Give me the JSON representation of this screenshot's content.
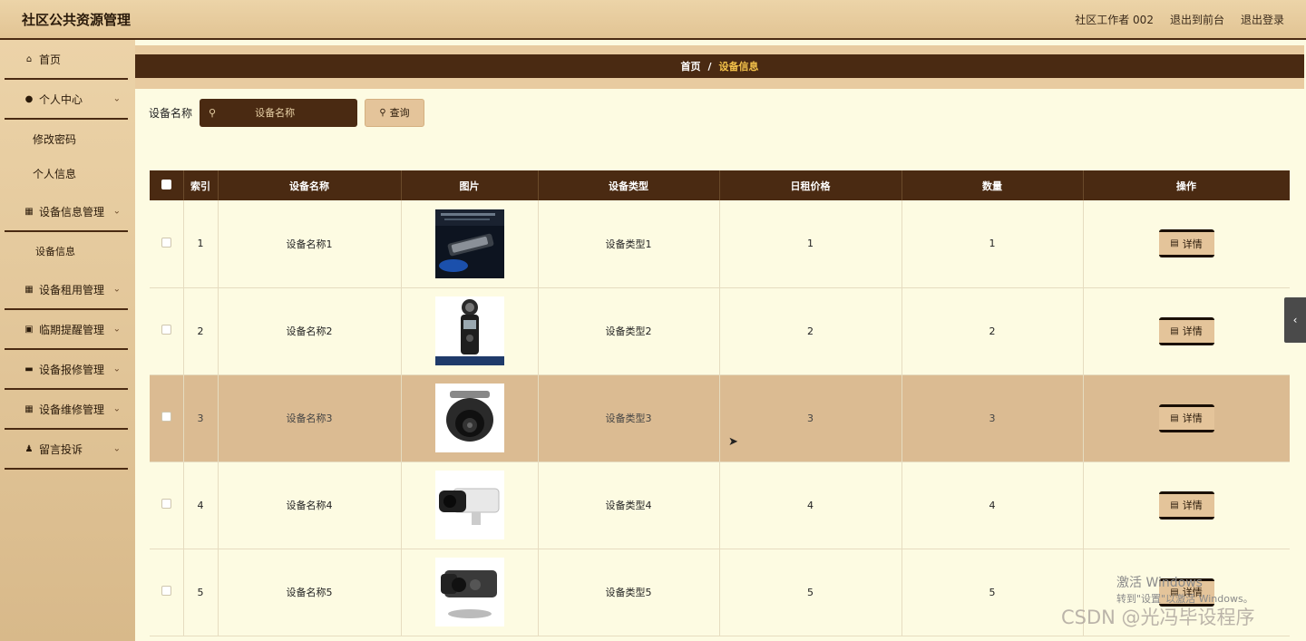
{
  "app": {
    "title": "社区公共资源管理",
    "user_label": "社区工作者 002",
    "to_front_label": "退出到前台",
    "logout_label": "退出登录"
  },
  "sidebar": {
    "home": "首页",
    "personal_center": "个人中心",
    "personal_sub": [
      "修改密码",
      "个人信息"
    ],
    "device_info_mgmt": "设备信息管理",
    "device_info_sub": "设备信息",
    "rental_mgmt": "设备租用管理",
    "expiry_mgmt": "临期提醒管理",
    "repair_report_mgmt": "设备报修管理",
    "maintenance_mgmt": "设备维修管理",
    "complaints": "留言投诉"
  },
  "breadcrumb": {
    "home": "首页",
    "separator": "/",
    "current": "设备信息"
  },
  "search": {
    "label": "设备名称",
    "placeholder": "设备名称",
    "button_label": "查询"
  },
  "table": {
    "headers": [
      "索引",
      "设备名称",
      "图片",
      "设备类型",
      "日租价格",
      "数量",
      "操作"
    ],
    "detail_label": "详情",
    "rows": [
      {
        "index": "1",
        "name": "设备名称1",
        "image": "recorder-pen-photo",
        "type": "设备类型1",
        "price": "1",
        "qty": "1"
      },
      {
        "index": "2",
        "name": "设备名称2",
        "image": "zoom-h5-recorder-photo",
        "type": "设备类型2",
        "price": "2",
        "qty": "2"
      },
      {
        "index": "3",
        "name": "设备名称3",
        "image": "dome-camera-photo",
        "type": "设备类型3",
        "price": "3",
        "qty": "3"
      },
      {
        "index": "4",
        "name": "设备名称4",
        "image": "bullet-camera-photo",
        "type": "设备类型4",
        "price": "4",
        "qty": "4"
      },
      {
        "index": "5",
        "name": "设备名称5",
        "image": "bullet-camera-2-photo",
        "type": "设备类型5",
        "price": "5",
        "qty": "5"
      }
    ]
  },
  "watermark": {
    "windows_line1": "激活 Windows",
    "windows_line2": "转到\"设置\"以激活 Windows。",
    "csdn": "CSDN @光冯毕设程序"
  },
  "colors": {
    "accent_dark": "#4a2a12",
    "accent_tan": "#e4c49a",
    "highlight_row": "#dbbb92",
    "breadcrumb_current": "#f4c24a"
  }
}
